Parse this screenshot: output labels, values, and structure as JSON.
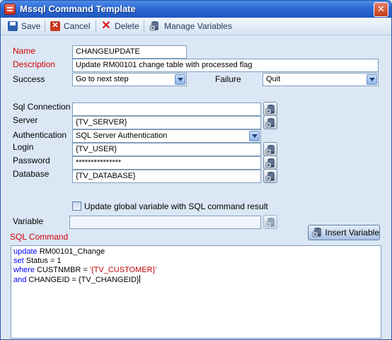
{
  "window": {
    "title": "Mssql Command Template",
    "close_glyph": "✕"
  },
  "toolbar": {
    "save": "Save",
    "cancel": "Cancel",
    "delete": "Delete",
    "manage_variables": "Manage Variables"
  },
  "form": {
    "name": {
      "label": "Name",
      "value": "CHANGEUPDATE"
    },
    "description": {
      "label": "Description",
      "value": "Update RM00101 change table with processed flag"
    },
    "success": {
      "label": "Success",
      "value": "Go to next step"
    },
    "failure": {
      "label": "Failure",
      "value": "Quit"
    },
    "sql_connection": {
      "label": "Sql Connection",
      "value": ""
    },
    "server": {
      "label": "Server",
      "value": "{TV_SERVER}"
    },
    "authentication": {
      "label": "Authentication",
      "value": "SQL Server Authentication"
    },
    "login": {
      "label": "Login",
      "value": "{TV_USER}"
    },
    "password": {
      "label": "Password",
      "value": "***************"
    },
    "database": {
      "label": "Database",
      "value": "{TV_DATABASE}"
    },
    "update_global": {
      "label": "Update global variable with SQL command result",
      "checked": false
    },
    "variable": {
      "label": "Variable",
      "value": ""
    },
    "sql_command": {
      "label": "SQL Command"
    },
    "insert_variable": "Insert Variable"
  },
  "sql": {
    "line1_kw": "update",
    "line1_rest": " RM00101_Change",
    "line2_kw": "set",
    "line2_rest": " Status = 1",
    "line3_kw": "where",
    "line3_rest": " CUSTNMBR = ",
    "line3_str": "'{TV_CUSTOMER}'",
    "line4_kw": "and",
    "line4_rest": " CHANGEID = {TV_CHANGEID}"
  },
  "colors": {
    "title_bar": "#2d69d4",
    "required_label": "#d40000",
    "keyword": "#0000ff",
    "string": "#c00000"
  },
  "icons": [
    "app-icon",
    "save-icon",
    "cancel-icon",
    "delete-icon",
    "database-icon",
    "chevron-down-icon",
    "checkbox"
  ]
}
